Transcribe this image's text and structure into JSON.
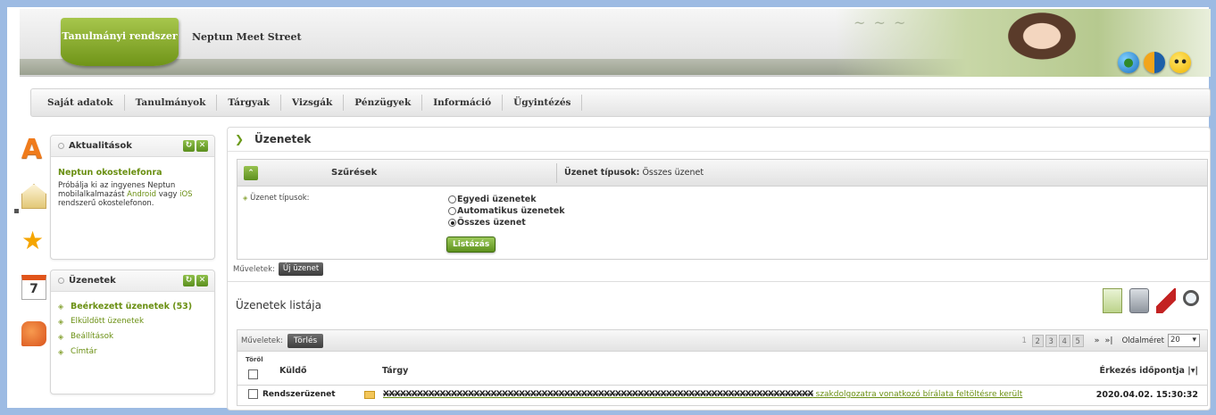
{
  "header": {
    "badge": "Tanulmányi rendszer",
    "app_name": "Neptun Meet Street",
    "icons": [
      "globe-icon",
      "contrast-icon",
      "smile-icon"
    ]
  },
  "nav": {
    "items": [
      "Saját adatok",
      "Tanulmányok",
      "Tárgyak",
      "Vizsgák",
      "Pénzügyek",
      "Információ",
      "Ügyintézés"
    ]
  },
  "rail": {
    "calendar_day": "7"
  },
  "news_box": {
    "title": "Aktualitások",
    "headline": "Neptun okostelefonra",
    "text_1": "Próbálja ki az ingyenes Neptun mobilalkalmazást ",
    "link_android": "Android",
    "text_2": " vagy ",
    "link_ios": "iOS",
    "text_3": " rendszerű okostelefonon."
  },
  "messages_box": {
    "title": "Üzenetek",
    "items": [
      "Beérkezett üzenetek (53)",
      "Elküldött üzenetek",
      "Beállítások",
      "Címtár"
    ]
  },
  "main": {
    "title": "Üzenetek",
    "filter": {
      "label": "Szűrések",
      "type_label": "Üzenet típusok:",
      "type_value": "Összes üzenet",
      "field_label": "Üzenet típusok:",
      "options": [
        "Egyedi üzenetek",
        "Automatikus üzenetek",
        "Összes üzenet"
      ],
      "selected_index": 2,
      "submit": "Listázás"
    },
    "ops_label": "Műveletek:",
    "new_message": "Új üzenet",
    "list_title": "Üzenetek listája",
    "list": {
      "ops_label": "Műveletek:",
      "delete_button": "Törlés",
      "pages": [
        "1",
        "2",
        "3",
        "4",
        "5"
      ],
      "pager_next": "»",
      "pager_last": "»|",
      "page_size_label": "Oldalméret",
      "page_size": "20",
      "columns": {
        "delete": "Töröl",
        "sender": "Küldő",
        "subject": "Tárgy",
        "arrival": "Érkezés időpontja"
      },
      "rows": [
        {
          "sender": "Rendszerüzenet",
          "subject_redacted": "XXXXXXXXXXXXXXXXXXXXXXXXXXXXXXXXXXXXXXXXXXXXXXXXXXXXXXXXXXXXXXXXXXXXXXXXXXXX",
          "subject_tail": " szakdolgozatra vonatkozó bírálata feltöltésre került",
          "arrival": "2020.04.02. 15:30:32"
        }
      ]
    }
  }
}
